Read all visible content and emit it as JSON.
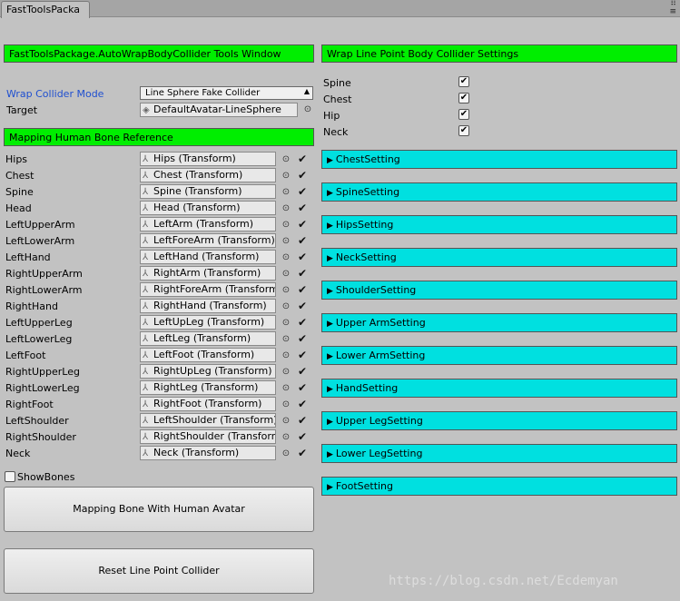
{
  "window": {
    "tab_label": "FastToolsPacka",
    "icon_dots": "⠿",
    "icon_menu": "≡"
  },
  "left": {
    "header_title": "FastToolsPackage.AutoWrapBodyCollider Tools Window",
    "mode_label": "Wrap Collider Mode",
    "mode_value": "Line Sphere Fake Collider",
    "target_label": "Target",
    "target_value": "DefaultAvatar-LineSphere",
    "mapping_title": "Mapping Human Bone Reference",
    "bones": [
      {
        "label": "Hips",
        "value": "Hips (Transform)"
      },
      {
        "label": "Chest",
        "value": "Chest (Transform)"
      },
      {
        "label": "Spine",
        "value": "Spine (Transform)"
      },
      {
        "label": "Head",
        "value": "Head (Transform)"
      },
      {
        "label": "LeftUpperArm",
        "value": "LeftArm (Transform)"
      },
      {
        "label": "LeftLowerArm",
        "value": "LeftForeArm (Transform)"
      },
      {
        "label": "LeftHand",
        "value": "LeftHand (Transform)"
      },
      {
        "label": "RightUpperArm",
        "value": "RightArm (Transform)"
      },
      {
        "label": "RightLowerArm",
        "value": "RightForeArm (Transform)"
      },
      {
        "label": "RightHand",
        "value": "RightHand (Transform)"
      },
      {
        "label": "LeftUpperLeg",
        "value": "LeftUpLeg (Transform)"
      },
      {
        "label": "LeftLowerLeg",
        "value": "LeftLeg (Transform)"
      },
      {
        "label": "LeftFoot",
        "value": "LeftFoot (Transform)"
      },
      {
        "label": "RightUpperLeg",
        "value": "RightUpLeg (Transform)"
      },
      {
        "label": "RightLowerLeg",
        "value": "RightLeg (Transform)"
      },
      {
        "label": "RightFoot",
        "value": "RightFoot (Transform)"
      },
      {
        "label": "LeftShoulder",
        "value": "LeftShoulder (Transform)"
      },
      {
        "label": "RightShoulder",
        "value": "RightShoulder (Transform)"
      },
      {
        "label": "Neck",
        "value": "Neck (Transform)"
      }
    ],
    "show_bones_label": "ShowBones",
    "show_bones_checked": false,
    "mapping_button": "Mapping Bone With Human Avatar",
    "reset_button": "Reset Line Point Collider"
  },
  "right": {
    "header_title": "Wrap Line Point Body Collider Settings",
    "toggles": [
      {
        "label": "Spine",
        "checked": true
      },
      {
        "label": "Chest",
        "checked": true
      },
      {
        "label": "Hip",
        "checked": true
      },
      {
        "label": "Neck",
        "checked": true
      }
    ],
    "foldouts": [
      "ChestSetting",
      "SpineSetting",
      "HipsSetting",
      "NeckSetting",
      "ShoulderSetting",
      "Upper ArmSetting",
      "Lower ArmSetting",
      "HandSetting",
      "Upper LegSetting",
      "Lower LegSetting",
      "FootSetting"
    ]
  },
  "watermark": "https://blog.csdn.net/Ecdemyan",
  "icons": {
    "bone": "bone-transform-icon",
    "picker": "object-picker-icon",
    "check": "checkmark-icon",
    "foldout": "triangle-right-icon"
  },
  "colors": {
    "header_green": "#00ee00",
    "foldout_cyan": "#00e0e0",
    "background": "#c2c2c2",
    "label_blue": "#1f4fd0"
  }
}
